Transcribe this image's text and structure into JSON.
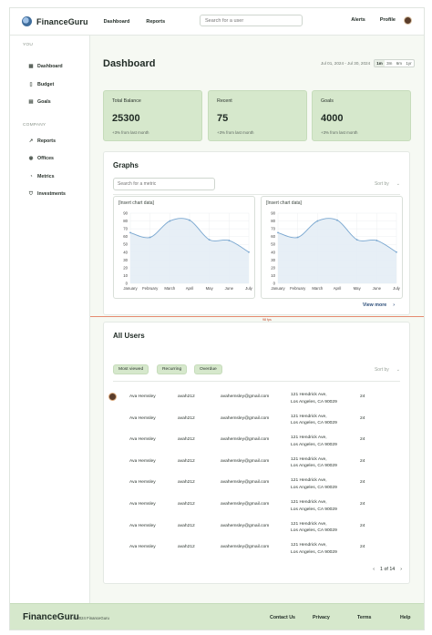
{
  "app": {
    "name": "FinanceGuru"
  },
  "topnav": {
    "dashboard": "Dashboard",
    "reports": "Reports"
  },
  "search": {
    "placeholder": "Search for a user"
  },
  "topright": {
    "alerts": "Alerts",
    "profile": "Profile"
  },
  "sidebar": {
    "you_label": "YOU",
    "company_label": "COMPANY",
    "you_items": [
      {
        "label": "Dashboard",
        "icon": "grid-icon"
      },
      {
        "label": "Budget",
        "icon": "document-icon"
      },
      {
        "label": "Goals",
        "icon": "calendar-icon"
      }
    ],
    "company_items": [
      {
        "label": "Reports",
        "icon": "trend-icon"
      },
      {
        "label": "Offices",
        "icon": "pin-icon"
      },
      {
        "label": "Metrics",
        "icon": "chart-icon"
      },
      {
        "label": "Investments",
        "icon": "shield-icon"
      }
    ]
  },
  "page": {
    "title": "Dashboard",
    "date_range": "Jul 01, 2024 - Jul 30, 2024",
    "ranges": [
      "1m",
      "3m",
      "6m",
      "1yr"
    ],
    "active_range": "1m"
  },
  "stats": [
    {
      "label": "Total Balance",
      "value": "25300",
      "delta": "+3% from last month"
    },
    {
      "label": "Recent",
      "value": "75",
      "delta": "+3% from last month"
    },
    {
      "label": "Goals",
      "value": "4000",
      "delta": "+3% from last month"
    }
  ],
  "graphs": {
    "title": "Graphs",
    "search_placeholder": "Search for a metric",
    "sort_label": "Sort by",
    "view_more": "View more"
  },
  "chart_data": [
    {
      "type": "area",
      "title": "[Insert chart data]",
      "categories": [
        "January",
        "February",
        "March",
        "April",
        "May",
        "June",
        "July"
      ],
      "series": [
        {
          "values": [
            65,
            59,
            80,
            81,
            56,
            55,
            40
          ]
        }
      ],
      "yticks": [
        "0",
        "10",
        "20",
        "30",
        "40",
        "50",
        "60",
        "70",
        "80",
        "90"
      ],
      "ylim": [
        0,
        90
      ],
      "grid": true
    },
    {
      "type": "area",
      "title": "[Insert chart data]",
      "categories": [
        "January",
        "February",
        "March",
        "April",
        "May",
        "June",
        "July"
      ],
      "series": [
        {
          "values": [
            65,
            59,
            80,
            81,
            56,
            55,
            40
          ]
        }
      ],
      "yticks": [
        "0",
        "10",
        "20",
        "30",
        "40",
        "50",
        "60",
        "70",
        "80",
        "90"
      ],
      "ylim": [
        0,
        90
      ],
      "grid": true
    }
  ],
  "divider_label": "98 fps",
  "users": {
    "title": "All Users",
    "filters": [
      "Most viewed",
      "Recurring",
      "Overdue"
    ],
    "sort_label": "Sort by",
    "rows": [
      {
        "name": "Ava Hemsley",
        "username": "avah212",
        "email": "avahemsley@gmail.com",
        "addr1": "121 Hendrick Ave,",
        "addr2": "Los Angeles, CA 90029",
        "age": "24"
      },
      {
        "name": "Ava Hemsley",
        "username": "avah212",
        "email": "avahemsley@gmail.com",
        "addr1": "121 Hendrick Ave,",
        "addr2": "Los Angeles, CA 90029",
        "age": "24"
      },
      {
        "name": "Ava Hemsley",
        "username": "avah212",
        "email": "avahemsley@gmail.com",
        "addr1": "121 Hendrick Ave,",
        "addr2": "Los Angeles, CA 90029",
        "age": "24"
      },
      {
        "name": "Ava Hemsley",
        "username": "avah212",
        "email": "avahemsley@gmail.com",
        "addr1": "121 Hendrick Ave,",
        "addr2": "Los Angeles, CA 90029",
        "age": "24"
      },
      {
        "name": "Ava Hemsley",
        "username": "avah212",
        "email": "avahemsley@gmail.com",
        "addr1": "121 Hendrick Ave,",
        "addr2": "Los Angeles, CA 90029",
        "age": "24"
      },
      {
        "name": "Ava Hemsley",
        "username": "avah212",
        "email": "avahemsley@gmail.com",
        "addr1": "121 Hendrick Ave,",
        "addr2": "Los Angeles, CA 90029",
        "age": "24"
      },
      {
        "name": "Ava Hemsley",
        "username": "avah212",
        "email": "avahemsley@gmail.com",
        "addr1": "121 Hendrick Ave,",
        "addr2": "Los Angeles, CA 90029",
        "age": "24"
      },
      {
        "name": "Ava Hemsley",
        "username": "avah212",
        "email": "avahemsley@gmail.com",
        "addr1": "121 Hendrick Ave,",
        "addr2": "Los Angeles, CA 90029",
        "age": "24"
      }
    ],
    "pagination": "1 of 14"
  },
  "footer": {
    "brand": "FinanceGuru",
    "copyright": "© 2024 FinanceGuru",
    "links": [
      "Contact Us",
      "Privacy",
      "Terms",
      "Help"
    ]
  },
  "colors": {
    "accent_green": "#d6e8cc",
    "link_blue": "#2d4f7a",
    "chart_line": "#7aa7d0",
    "chart_fill": "#e4edf5"
  }
}
